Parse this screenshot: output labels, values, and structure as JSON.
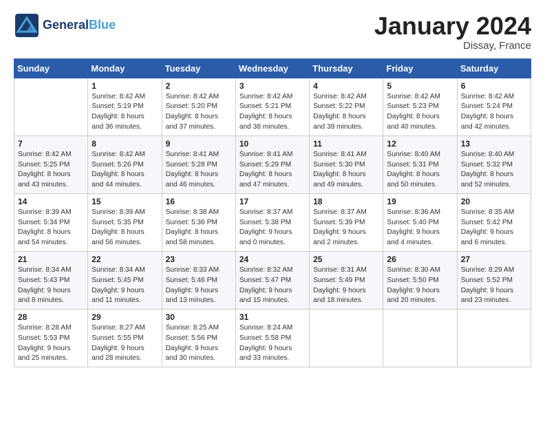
{
  "header": {
    "logo_general": "General",
    "logo_blue": "Blue",
    "month_title": "January 2024",
    "location": "Dissay, France"
  },
  "days_of_week": [
    "Sunday",
    "Monday",
    "Tuesday",
    "Wednesday",
    "Thursday",
    "Friday",
    "Saturday"
  ],
  "weeks": [
    [
      {
        "day": "",
        "info": ""
      },
      {
        "day": "1",
        "info": "Sunrise: 8:42 AM\nSunset: 5:19 PM\nDaylight: 8 hours\nand 36 minutes."
      },
      {
        "day": "2",
        "info": "Sunrise: 8:42 AM\nSunset: 5:20 PM\nDaylight: 8 hours\nand 37 minutes."
      },
      {
        "day": "3",
        "info": "Sunrise: 8:42 AM\nSunset: 5:21 PM\nDaylight: 8 hours\nand 38 minutes."
      },
      {
        "day": "4",
        "info": "Sunrise: 8:42 AM\nSunset: 5:22 PM\nDaylight: 8 hours\nand 39 minutes."
      },
      {
        "day": "5",
        "info": "Sunrise: 8:42 AM\nSunset: 5:23 PM\nDaylight: 8 hours\nand 40 minutes."
      },
      {
        "day": "6",
        "info": "Sunrise: 8:42 AM\nSunset: 5:24 PM\nDaylight: 8 hours\nand 42 minutes."
      }
    ],
    [
      {
        "day": "7",
        "info": "Sunrise: 8:42 AM\nSunset: 5:25 PM\nDaylight: 8 hours\nand 43 minutes."
      },
      {
        "day": "8",
        "info": "Sunrise: 8:42 AM\nSunset: 5:26 PM\nDaylight: 8 hours\nand 44 minutes."
      },
      {
        "day": "9",
        "info": "Sunrise: 8:41 AM\nSunset: 5:28 PM\nDaylight: 8 hours\nand 46 minutes."
      },
      {
        "day": "10",
        "info": "Sunrise: 8:41 AM\nSunset: 5:29 PM\nDaylight: 8 hours\nand 47 minutes."
      },
      {
        "day": "11",
        "info": "Sunrise: 8:41 AM\nSunset: 5:30 PM\nDaylight: 8 hours\nand 49 minutes."
      },
      {
        "day": "12",
        "info": "Sunrise: 8:40 AM\nSunset: 5:31 PM\nDaylight: 8 hours\nand 50 minutes."
      },
      {
        "day": "13",
        "info": "Sunrise: 8:40 AM\nSunset: 5:32 PM\nDaylight: 8 hours\nand 52 minutes."
      }
    ],
    [
      {
        "day": "14",
        "info": "Sunrise: 8:39 AM\nSunset: 5:34 PM\nDaylight: 8 hours\nand 54 minutes."
      },
      {
        "day": "15",
        "info": "Sunrise: 8:39 AM\nSunset: 5:35 PM\nDaylight: 8 hours\nand 56 minutes."
      },
      {
        "day": "16",
        "info": "Sunrise: 8:38 AM\nSunset: 5:36 PM\nDaylight: 8 hours\nand 58 minutes."
      },
      {
        "day": "17",
        "info": "Sunrise: 8:37 AM\nSunset: 5:38 PM\nDaylight: 9 hours\nand 0 minutes."
      },
      {
        "day": "18",
        "info": "Sunrise: 8:37 AM\nSunset: 5:39 PM\nDaylight: 9 hours\nand 2 minutes."
      },
      {
        "day": "19",
        "info": "Sunrise: 8:36 AM\nSunset: 5:40 PM\nDaylight: 9 hours\nand 4 minutes."
      },
      {
        "day": "20",
        "info": "Sunrise: 8:35 AM\nSunset: 5:42 PM\nDaylight: 9 hours\nand 6 minutes."
      }
    ],
    [
      {
        "day": "21",
        "info": "Sunrise: 8:34 AM\nSunset: 5:43 PM\nDaylight: 9 hours\nand 8 minutes."
      },
      {
        "day": "22",
        "info": "Sunrise: 8:34 AM\nSunset: 5:45 PM\nDaylight: 9 hours\nand 11 minutes."
      },
      {
        "day": "23",
        "info": "Sunrise: 8:33 AM\nSunset: 5:46 PM\nDaylight: 9 hours\nand 13 minutes."
      },
      {
        "day": "24",
        "info": "Sunrise: 8:32 AM\nSunset: 5:47 PM\nDaylight: 9 hours\nand 15 minutes."
      },
      {
        "day": "25",
        "info": "Sunrise: 8:31 AM\nSunset: 5:49 PM\nDaylight: 9 hours\nand 18 minutes."
      },
      {
        "day": "26",
        "info": "Sunrise: 8:30 AM\nSunset: 5:50 PM\nDaylight: 9 hours\nand 20 minutes."
      },
      {
        "day": "27",
        "info": "Sunrise: 8:29 AM\nSunset: 5:52 PM\nDaylight: 9 hours\nand 23 minutes."
      }
    ],
    [
      {
        "day": "28",
        "info": "Sunrise: 8:28 AM\nSunset: 5:53 PM\nDaylight: 9 hours\nand 25 minutes."
      },
      {
        "day": "29",
        "info": "Sunrise: 8:27 AM\nSunset: 5:55 PM\nDaylight: 9 hours\nand 28 minutes."
      },
      {
        "day": "30",
        "info": "Sunrise: 8:25 AM\nSunset: 5:56 PM\nDaylight: 9 hours\nand 30 minutes."
      },
      {
        "day": "31",
        "info": "Sunrise: 8:24 AM\nSunset: 5:58 PM\nDaylight: 9 hours\nand 33 minutes."
      },
      {
        "day": "",
        "info": ""
      },
      {
        "day": "",
        "info": ""
      },
      {
        "day": "",
        "info": ""
      }
    ]
  ]
}
